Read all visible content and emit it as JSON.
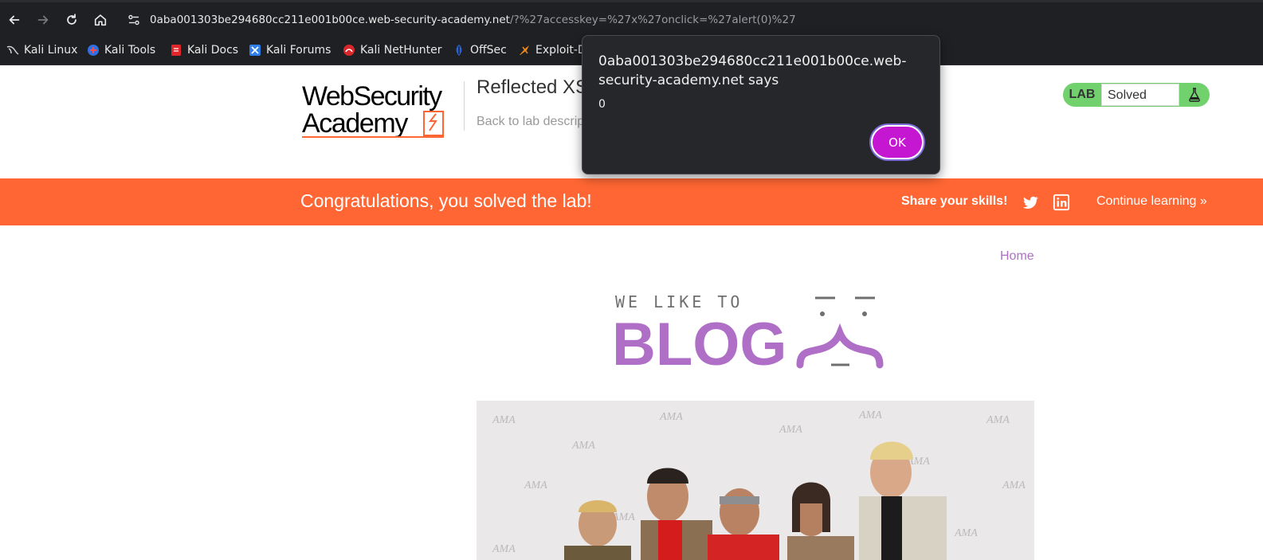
{
  "browser": {
    "url_host": "0aba001303be294680cc211e001b00ce.web-security-academy.net",
    "url_path": "/?%27accesskey=%27x%27onclick=%27alert(0)%27",
    "bookmarks": [
      "Kali Linux",
      "Kali Tools",
      "Kali Docs",
      "Kali Forums",
      "Kali NetHunter",
      "OffSec",
      "Exploit-D"
    ]
  },
  "lab": {
    "logo_line1": "WebSecurity",
    "logo_line2": "Academy",
    "title": "Reflected XS",
    "back_link": "Back to lab descrip",
    "status_label": "LAB",
    "status_value": "Solved"
  },
  "banner": {
    "congrats": "Congratulations, you solved the lab!",
    "share": "Share your skills!",
    "continue": "Continue learning »"
  },
  "main": {
    "home_link": "Home",
    "blog_line1": "WE LIKE TO",
    "blog_line2": "BLOG"
  },
  "dialog": {
    "title": "0aba001303be294680cc211e001b00ce.web-security-academy.net says",
    "message": "0",
    "ok_label": "OK"
  },
  "colors": {
    "banner": "#ff6633",
    "lab_status": "#70d16d",
    "ok_button": "#c516d2",
    "home_link": "#b06fc6"
  }
}
